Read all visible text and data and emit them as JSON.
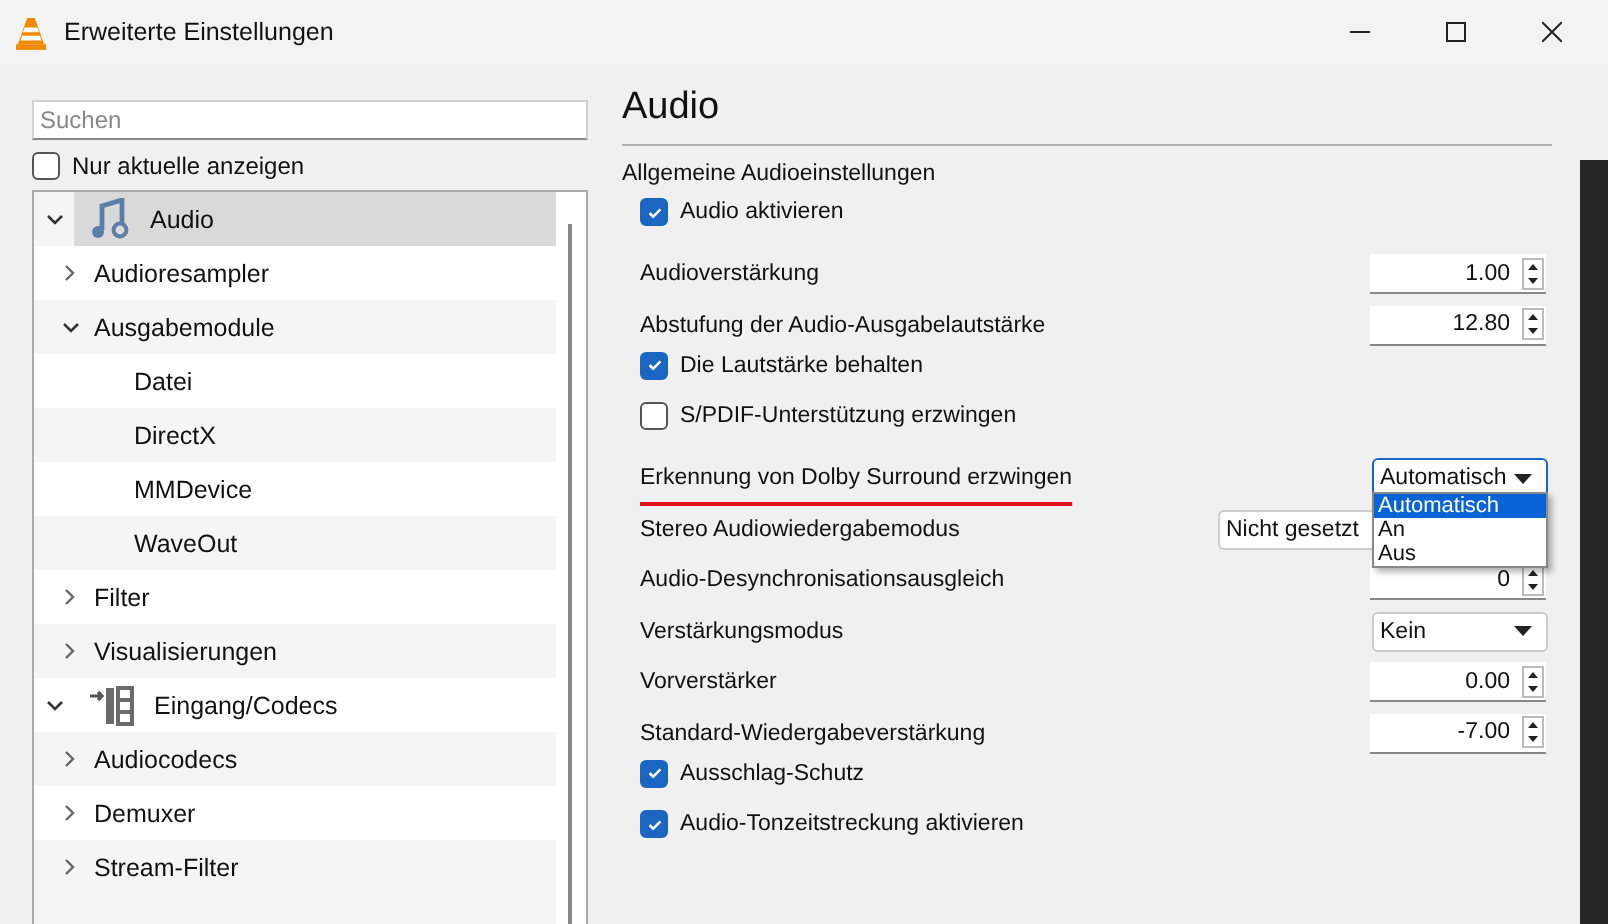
{
  "window": {
    "title": "Erweiterte Einstellungen"
  },
  "sidebar": {
    "search": {
      "placeholder": "Suchen"
    },
    "only_current": {
      "label": "Nur aktuelle anzeigen",
      "checked": false
    },
    "tree": [
      {
        "label": "Audio",
        "expanded": true,
        "selected": true,
        "children": [
          {
            "label": "Audioresampler",
            "expanded": false,
            "selected": false
          },
          {
            "label": "Ausgabemodule",
            "expanded": true,
            "selected": false,
            "children": [
              {
                "label": "Datei",
                "selected": false
              },
              {
                "label": "DirectX",
                "selected": false
              },
              {
                "label": "MMDevice",
                "selected": false
              },
              {
                "label": "WaveOut",
                "selected": false
              }
            ]
          },
          {
            "label": "Filter",
            "expanded": false,
            "selected": false
          },
          {
            "label": "Visualisierungen",
            "expanded": false,
            "selected": false
          }
        ]
      },
      {
        "label": "Eingang/Codecs",
        "expanded": true,
        "selected": false,
        "children": [
          {
            "label": "Audiocodecs",
            "expanded": false,
            "selected": false
          },
          {
            "label": "Demuxer",
            "expanded": false,
            "selected": false
          },
          {
            "label": "Stream-Filter",
            "expanded": false,
            "selected": false
          }
        ]
      }
    ]
  },
  "panel": {
    "title": "Audio",
    "section": "Allgemeine Audioeinstellungen",
    "settings": [
      {
        "kind": "checkbox",
        "label": "Audio aktivieren",
        "checked": true
      },
      {
        "kind": "spin",
        "label": "Audioverstärkung",
        "value": "1.00"
      },
      {
        "kind": "spin",
        "label": "Abstufung der Audio-Ausgabelautstärke",
        "value": "12.80"
      },
      {
        "kind": "checkbox",
        "label": "Die Lautstärke behalten",
        "checked": true
      },
      {
        "kind": "checkbox",
        "label": "S/PDIF-Unterstützung erzwingen",
        "checked": false
      },
      {
        "kind": "combo",
        "label": "Erkennung von Dolby Surround erzwingen",
        "value": "Automatisch",
        "focused": true,
        "underlined": true,
        "open_options": [
          {
            "label": "Automatisch",
            "selected": true
          },
          {
            "label": "An",
            "selected": false
          },
          {
            "label": "Aus",
            "selected": false
          }
        ]
      },
      {
        "kind": "combo",
        "label": "Stereo Audiowiedergabemodus",
        "value": "Nicht gesetzt",
        "wide": true
      },
      {
        "kind": "spin",
        "label": "Audio-Desynchronisationsausgleich",
        "value": "0"
      },
      {
        "kind": "combo",
        "label": "Verstärkungsmodus",
        "value": "Kein"
      },
      {
        "kind": "spin",
        "label": "Vorverstärker",
        "value": "0.00"
      },
      {
        "kind": "spin",
        "label": "Standard-Wiedergabeverstärkung",
        "value": "-7.00"
      },
      {
        "kind": "checkbox",
        "label": "Ausschlag-Schutz",
        "checked": true
      },
      {
        "kind": "checkbox",
        "label": "Audio-Tonzeitstreckung aktivieren",
        "checked": true
      }
    ]
  }
}
